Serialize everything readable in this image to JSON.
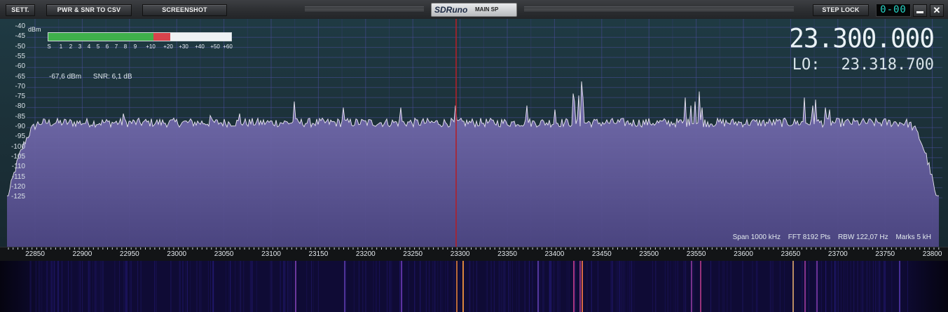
{
  "titlebar": {
    "settings_label": "SETT.",
    "csv_label": "PWR & SNR TO CSV",
    "screenshot_label": "SCREENSHOT",
    "brand": "SDRuno",
    "window_name": "MAIN SP",
    "step_lock_label": "STEP LOCK",
    "clock": "0-00",
    "minimize_icon": "minimize-icon",
    "close_icon": "close-icon"
  },
  "spectrum": {
    "unit": "dBm",
    "y_labels": [
      "-40",
      "-45",
      "-50",
      "-55",
      "-60",
      "-65",
      "-70",
      "-75",
      "-80",
      "-85",
      "-90",
      "-95",
      "-100",
      "-105",
      "-110",
      "-115",
      "-120",
      "-125"
    ],
    "smeter": {
      "level_fraction": 0.575,
      "over_s9_fraction": 0.09,
      "ticks": [
        "S",
        "1",
        "2",
        "3",
        "4",
        "5",
        "6",
        "7",
        "8",
        "9",
        "+10",
        "+20",
        "+30",
        "+40",
        "+50",
        "+60"
      ]
    },
    "power": "-67,6 dBm",
    "snr": "SNR: 6,1 dB",
    "vfo_frequency": "23.300.000",
    "lo_label": "LO:",
    "lo_frequency": "23.318.700",
    "info": {
      "span": "Span 1000 kHz",
      "fft": "FFT 8192 Pts",
      "rbw": "RBW 122,07 Hz",
      "marks": "Marks 5 kH"
    },
    "colors": {
      "accent_line": "#b0202a",
      "fill": "#5c5690",
      "trace": "#e9e6f0"
    }
  },
  "axis": {
    "x_labels": [
      "22850",
      "22900",
      "22950",
      "23000",
      "23050",
      "23100",
      "23150",
      "23200",
      "23250",
      "23300",
      "23350",
      "23400",
      "23450",
      "23500",
      "23550",
      "23600",
      "23650",
      "23700",
      "23750",
      "23800"
    ]
  }
}
